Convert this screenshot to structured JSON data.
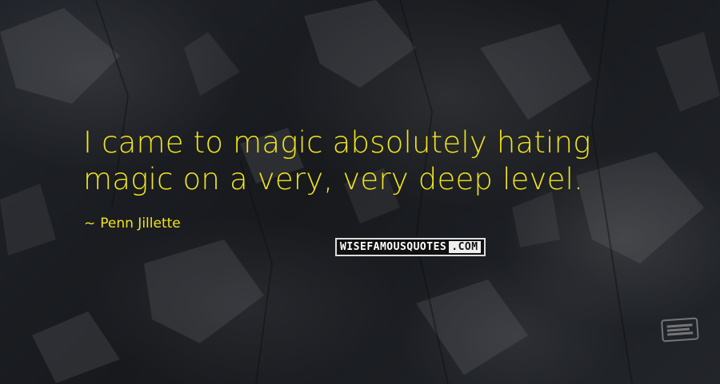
{
  "quote": {
    "line1": "I came to magic absolutely hating",
    "line2": "magic on a very, very deep level."
  },
  "author": {
    "dash": "~",
    "name": "Penn Jillette"
  },
  "brand": {
    "part1": "WISE",
    "part2": "FAMOUS",
    "part3": "QUOTES",
    "part4": ".COM"
  },
  "colors": {
    "quote_text": "#f2e51a",
    "background": "#1b1d22"
  }
}
